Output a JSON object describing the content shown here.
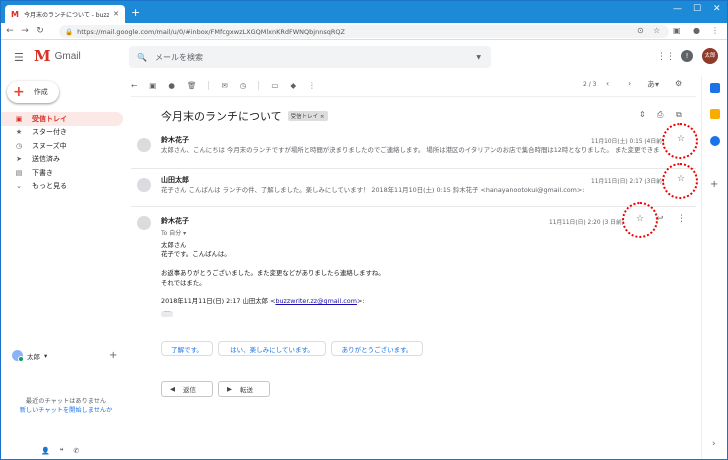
{
  "browser": {
    "tab_title": "今月末のランチについて - buzzwriter",
    "url": "https://mail.google.com/mail/u/0/#inbox/FMfcgxwzLXGQMlxnKRdFWNQbjnnsqRQZ"
  },
  "gmail": {
    "logo_text": "Gmail",
    "search_placeholder": "メールを検索",
    "avatar_text": "太郎"
  },
  "sidebar": {
    "compose_label": "作成",
    "items": [
      {
        "label": "受信トレイ",
        "icon": "inbox-icon",
        "active": true
      },
      {
        "label": "スター付き",
        "icon": "star-icon",
        "active": false
      },
      {
        "label": "スヌーズ中",
        "icon": "clock-icon",
        "active": false
      },
      {
        "label": "送信済み",
        "icon": "send-icon",
        "active": false
      },
      {
        "label": "下書き",
        "icon": "draft-icon",
        "active": false
      },
      {
        "label": "もっと見る",
        "icon": "chevron-down-icon",
        "active": false
      }
    ],
    "chat_user": "太郎",
    "no_chat": "最近のチャットはありません",
    "start_chat": "新しいチャットを開始しませんか"
  },
  "toolbar": {
    "pager": "2 / 3",
    "lang": "あ"
  },
  "thread": {
    "subject": "今月末のランチについて",
    "label": "受信トレイ ×",
    "messages": [
      {
        "sender": "鈴木花子",
        "date": "11月10日(土) 0:15 (4日前)",
        "snippet": "太郎さん、こんにちは 今月末のランチですが場所と時間が決まりましたのでご連絡します。 場所は港区のイタリアンのお店で集合時間は12時となりました。 また変更できま"
      },
      {
        "sender": "山田太郎",
        "date": "11月11日(日) 2:17 (3日前)",
        "snippet": "花子さん こんばんは ランチの件、了解しました。楽しみにしています！ 2018年11月10日(土) 0:15 鈴木花子 <hanayanootokui@gmail.com>:"
      },
      {
        "sender": "鈴木花子",
        "date": "11月11日(日) 2:20 (3 日前)",
        "to": "To 自分",
        "body": [
          "太郎さん",
          "花子です。こんばんは。",
          "",
          "お返事ありがとうございました。また変更などがありましたら連絡しますね。",
          "それではまた。"
        ],
        "quote_prefix": "2018年11月11日(日) 2:17 山田太郎 <",
        "quote_email": "buzzwriter.zz@gmail.com",
        "quote_suffix": ">:"
      }
    ],
    "smart_replies": [
      "了解です。",
      "はい、楽しみにしています。",
      "ありがとうございます。"
    ],
    "reply_label": "返信",
    "forward_label": "転送"
  }
}
